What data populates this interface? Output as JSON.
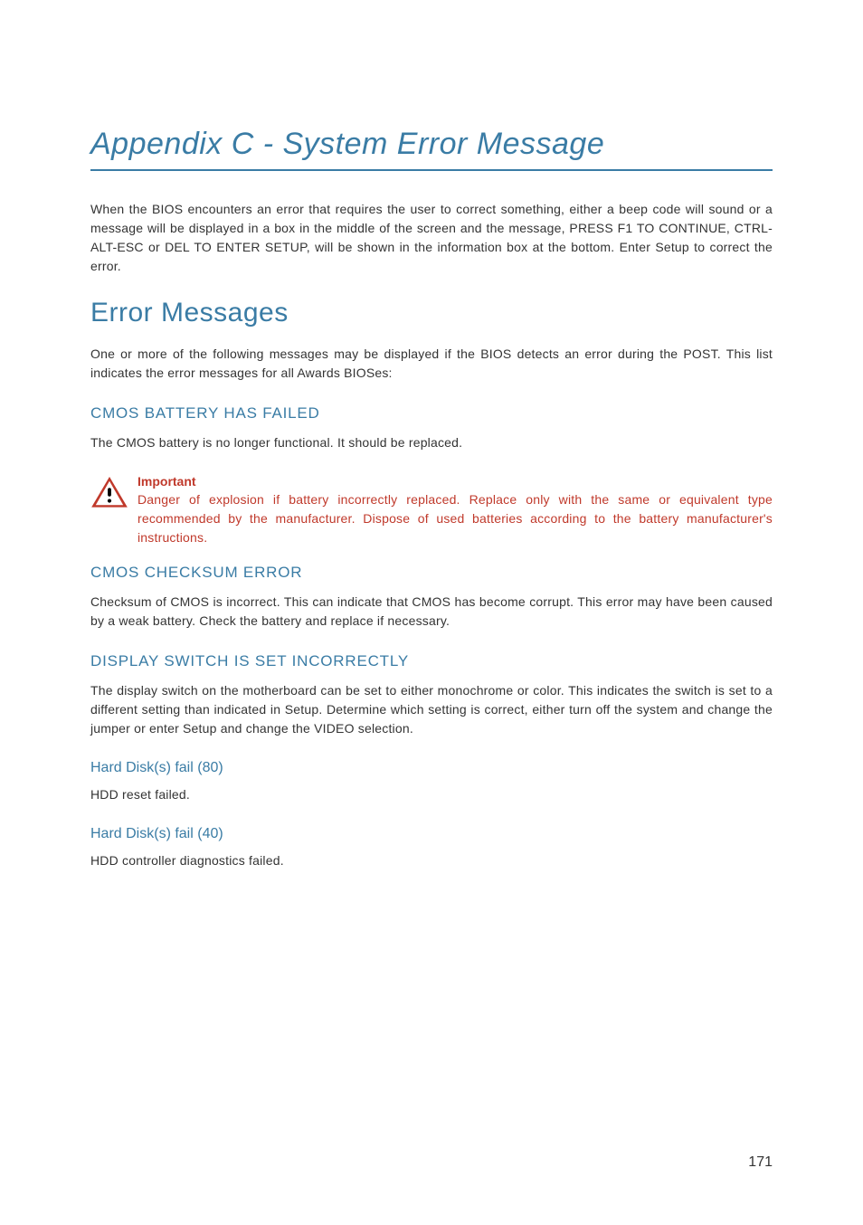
{
  "page": {
    "title": "Appendix C - System Error Message",
    "intro": "When the BIOS encounters an error that requires the user to correct something, either a beep code will sound or a message will be displayed in a box in the middle of the screen and the message, PRESS F1 TO CONTINUE, CTRL-ALT-ESC or DEL TO ENTER SETUP, will be shown in the information box at the bottom. Enter Setup to correct the error.",
    "page_number": "171"
  },
  "section": {
    "title": "Error Messages",
    "intro": "One or more of the following messages may be displayed if the BIOS detects an error during the POST. This list indicates the error messages for all Awards BIOSes:"
  },
  "cmos_battery": {
    "heading": "CMOS BATTERY HAS FAILED",
    "text": "The CMOS battery is no longer functional. It should be replaced."
  },
  "important": {
    "label": "Important",
    "text": "Danger of explosion if battery incorrectly replaced. Replace only with the same or equivalent type recommended by the manufacturer. Dispose of used batteries according to the battery manufacturer's instructions."
  },
  "cmos_checksum": {
    "heading": "CMOS CHECKSUM ERROR",
    "text": "Checksum of CMOS is incorrect. This can indicate that CMOS has become corrupt. This error may have been caused by a weak battery. Check the battery and replace if necessary."
  },
  "display_switch": {
    "heading": "DISPLAY SWITCH IS SET INCORRECTLY",
    "text": "The display switch on the motherboard can be set to either monochrome or color. This indicates the switch is set to a different setting than indicated in Setup. Determine which setting is correct, either turn off the system and change the jumper or enter Setup and change the VIDEO selection."
  },
  "hdd80": {
    "heading": "Hard Disk(s) fail (80)",
    "text": "HDD reset failed."
  },
  "hdd40": {
    "heading": "Hard Disk(s) fail (40)",
    "text": "HDD controller diagnostics failed."
  }
}
